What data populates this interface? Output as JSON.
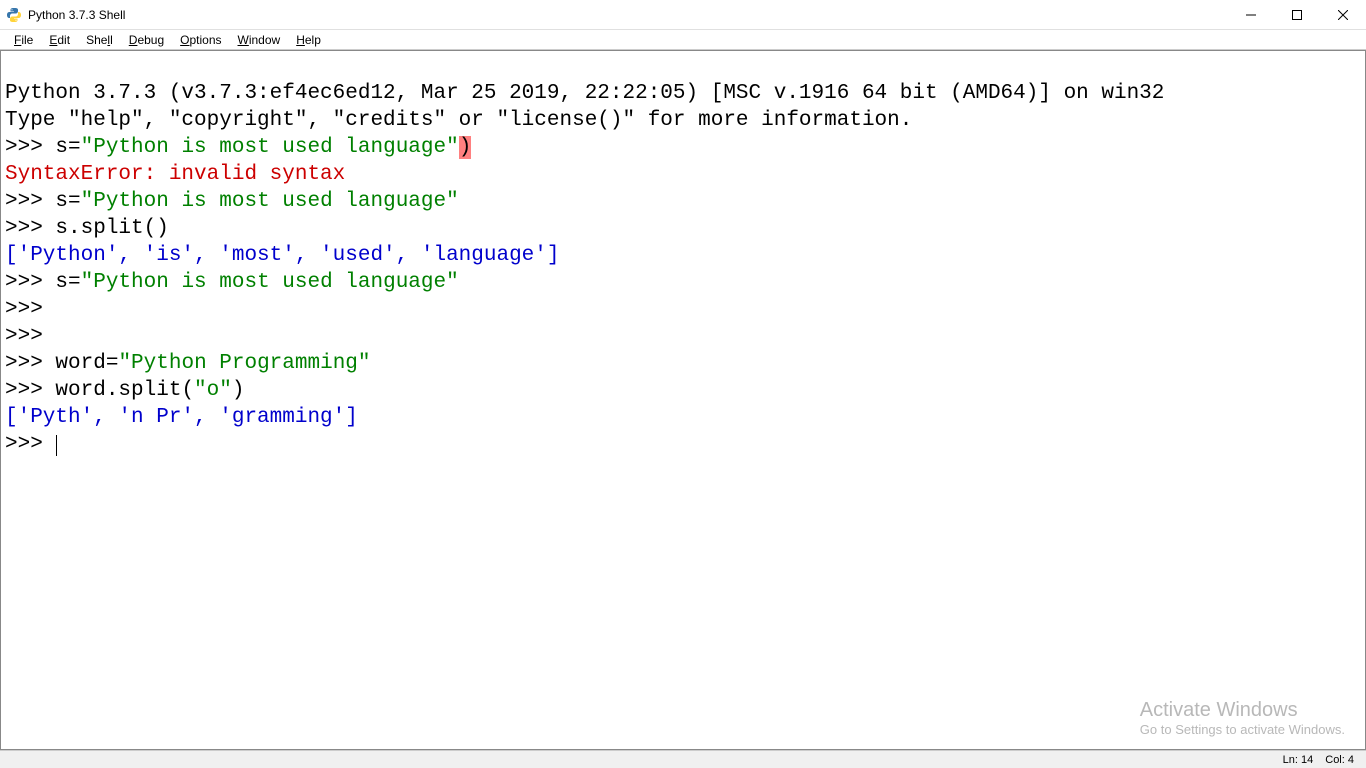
{
  "title": "Python 3.7.3 Shell",
  "menu": {
    "file": {
      "u": "F",
      "rest": "ile"
    },
    "edit": {
      "u": "E",
      "rest": "dit"
    },
    "shell": {
      "pre": "She",
      "u": "l",
      "post": "l"
    },
    "debug": {
      "u": "D",
      "rest": "ebug"
    },
    "options": {
      "u": "O",
      "rest": "ptions"
    },
    "window": {
      "u": "W",
      "rest": "indow"
    },
    "help": {
      "u": "H",
      "rest": "elp"
    }
  },
  "banner1": "Python 3.7.3 (v3.7.3:ef4ec6ed12, Mar 25 2019, 22:22:05) [MSC v.1916 64 bit (AMD64)] on win32",
  "banner2": "Type \"help\", \"copyright\", \"credits\" or \"license()\" for more information.",
  "prompt": ">>> ",
  "lines": {
    "l1": {
      "var": "s",
      "op": "=",
      "str": "\"Python is most used language\"",
      "errchar": ")"
    },
    "l2_err": "SyntaxError: invalid syntax",
    "l3": {
      "var": "s",
      "op": "=",
      "str": "\"Python is most used language\""
    },
    "l4_call": "s.split()",
    "l5_out": "['Python', 'is', 'most', 'used', 'language']",
    "l6": {
      "var": "s",
      "op": "=",
      "str": "\"Python is most used language\""
    },
    "l9": {
      "var": "word",
      "op": "=",
      "str": "\"Python Programming\""
    },
    "l10_call_pre": "word.split(",
    "l10_call_str": "\"o\"",
    "l10_call_post": ")",
    "l11_out": "['Pyth', 'n Pr', 'gramming']"
  },
  "watermark": {
    "line1": "Activate Windows",
    "line2": "Go to Settings to activate Windows."
  },
  "status": {
    "ln": "Ln: 14",
    "col": "Col: 4"
  }
}
